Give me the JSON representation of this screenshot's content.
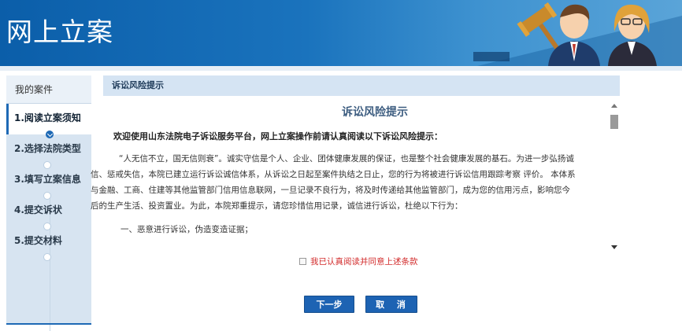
{
  "header": {
    "title": "网上立案"
  },
  "sidebar": {
    "heading": "我的案件",
    "steps": [
      {
        "label": "1.阅读立案须知",
        "state": "active"
      },
      {
        "label": "2.选择法院类型",
        "state": "pending"
      },
      {
        "label": "3.填写立案信息",
        "state": "pending"
      },
      {
        "label": "4.提交诉状",
        "state": "pending"
      },
      {
        "label": "5.提交材料",
        "state": "pending"
      }
    ]
  },
  "panel": {
    "heading": "诉讼风险提示",
    "doc_title": "诉讼风险提示",
    "lead": "欢迎使用山东法院电子诉讼服务平台，网上立案操作前请认真阅读以下诉讼风险提示：",
    "paragraph_line1": "“人无信不立，国无信则衰”。诚实守信是个人、企业、团体健康发展的保证，也是整个社会健康发展的基石。为进一步弘扬诚",
    "paragraph_line2": "信、惩戒失信，本院已建立运行诉讼诚信体系，从诉讼之日起至案件执结之日止，您的行为将被进行诉讼信用跟踪考察 评价。 本体系",
    "paragraph_line3": "与金融、工商、住建等其他监管部门信用信息联网，一旦记录不良行为，将及时传递给其他监管部门，成为您的信用污点，影响您今",
    "paragraph_line4": "后的生产生活、投资置业。为此，本院郑重提示，请您珍惜信用记录，诚信进行诉讼，杜绝以下行为：",
    "item1": "一、恶意进行诉讼，伪造变造证据；"
  },
  "agreement": {
    "label": "我已认真阅读并同意上述条款",
    "checked": false
  },
  "buttons": {
    "next": "下一步",
    "cancel": "取 消"
  },
  "colors": {
    "header_blue": "#0b5ea9",
    "button_blue": "#1d63b3",
    "agree_red": "#d22a2a",
    "panel_head": "#d5e4f3"
  }
}
